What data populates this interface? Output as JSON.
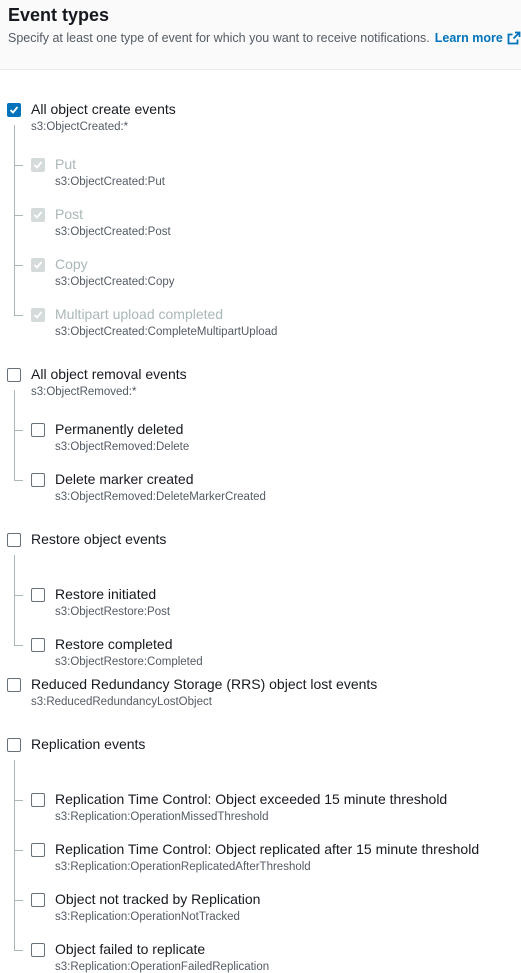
{
  "header": {
    "title": "Event types",
    "description": "Specify at least one type of event for which you want to receive notifications.",
    "learn_more": "Learn more"
  },
  "groups": [
    {
      "label": "All object create events",
      "code": "s3:ObjectCreated:*",
      "checked": true,
      "children": [
        {
          "label": "Put",
          "code": "s3:ObjectCreated:Put",
          "checked": true,
          "disabled": true
        },
        {
          "label": "Post",
          "code": "s3:ObjectCreated:Post",
          "checked": true,
          "disabled": true
        },
        {
          "label": "Copy",
          "code": "s3:ObjectCreated:Copy",
          "checked": true,
          "disabled": true
        },
        {
          "label": "Multipart upload completed",
          "code": "s3:ObjectCreated:CompleteMultipartUpload",
          "checked": true,
          "disabled": true
        }
      ]
    },
    {
      "label": "All object removal events",
      "code": "s3:ObjectRemoved:*",
      "checked": false,
      "children": [
        {
          "label": "Permanently deleted",
          "code": "s3:ObjectRemoved:Delete",
          "checked": false,
          "disabled": false
        },
        {
          "label": "Delete marker created",
          "code": "s3:ObjectRemoved:DeleteMarkerCreated",
          "checked": false,
          "disabled": false
        }
      ]
    },
    {
      "label": "Restore object events",
      "code": "",
      "checked": false,
      "children": [
        {
          "label": "Restore initiated",
          "code": "s3:ObjectRestore:Post",
          "checked": false,
          "disabled": false
        },
        {
          "label": "Restore completed",
          "code": "s3:ObjectRestore:Completed",
          "checked": false,
          "disabled": false
        }
      ]
    },
    {
      "label": "Reduced Redundancy Storage (RRS) object lost events",
      "code": "s3:ReducedRedundancyLostObject",
      "checked": false,
      "children": []
    },
    {
      "label": "Replication events",
      "code": "",
      "checked": false,
      "children": [
        {
          "label": "Replication Time Control: Object exceeded 15 minute threshold",
          "code": "s3:Replication:OperationMissedThreshold",
          "checked": false,
          "disabled": false
        },
        {
          "label": "Replication Time Control: Object replicated after 15 minute threshold",
          "code": "s3:Replication:OperationReplicatedAfterThreshold",
          "checked": false,
          "disabled": false
        },
        {
          "label": "Object not tracked by Replication",
          "code": "s3:Replication:OperationNotTracked",
          "checked": false,
          "disabled": false
        },
        {
          "label": "Object failed to replicate",
          "code": "s3:Replication:OperationFailedReplication",
          "checked": false,
          "disabled": false
        }
      ]
    }
  ]
}
